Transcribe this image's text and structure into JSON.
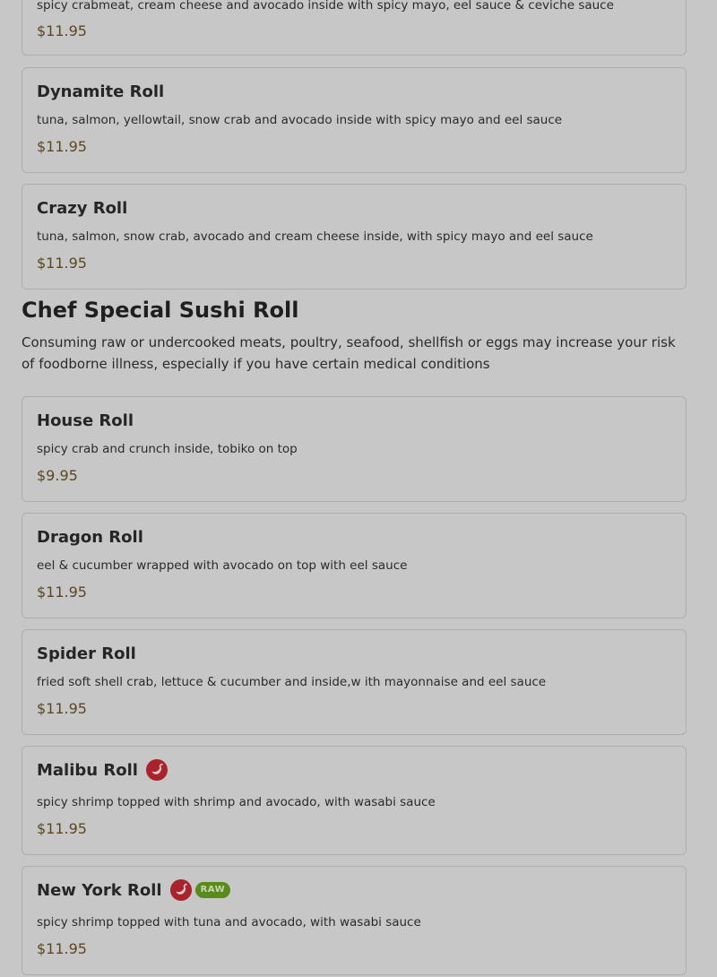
{
  "items_top": [
    {
      "name": "",
      "desc": "spicy crabmeat, cream cheese and avocado inside with spicy mayo, eel sauce & ceviche sauce",
      "price": "$11.95"
    },
    {
      "name": "Dynamite Roll",
      "desc": "tuna, salmon, yellowtail, snow crab and avocado inside with spicy mayo and eel sauce",
      "price": "$11.95"
    },
    {
      "name": "Crazy Roll",
      "desc": "tuna, salmon, snow crab, avocado and cream cheese inside, with spicy mayo and eel sauce",
      "price": "$11.95"
    }
  ],
  "section": {
    "title": "Chef Special Sushi Roll",
    "note": "Consuming raw or undercooked meats, poultry, seafood, shellfish or eggs may increase your risk of foodborne illness, especially if you have certain medical conditions"
  },
  "items": [
    {
      "name": "House Roll",
      "desc": "spicy crab and crunch inside, tobiko on top",
      "price": "$9.95"
    },
    {
      "name": "Dragon Roll",
      "desc": "eel & cucumber wrapped with avocado on top with eel sauce",
      "price": "$11.95"
    },
    {
      "name": "Spider Roll",
      "desc": "fried soft shell crab, lettuce & cucumber and inside,w ith mayonnaise and eel sauce",
      "price": "$11.95"
    },
    {
      "name": "Malibu Roll",
      "desc": "spicy shrimp topped with shrimp and avocado, with wasabi sauce",
      "price": "$11.95",
      "icons": [
        "spicy-icon"
      ]
    },
    {
      "name": "New York Roll",
      "desc": "spicy shrimp topped with tuna and avocado, with wasabi sauce",
      "price": "$11.95",
      "icons": [
        "spicy-icon"
      ],
      "badge": "RAW"
    }
  ],
  "colors": {
    "spicy": "#a8232c",
    "raw": "#5b8a1c",
    "price": "#5e4620"
  }
}
